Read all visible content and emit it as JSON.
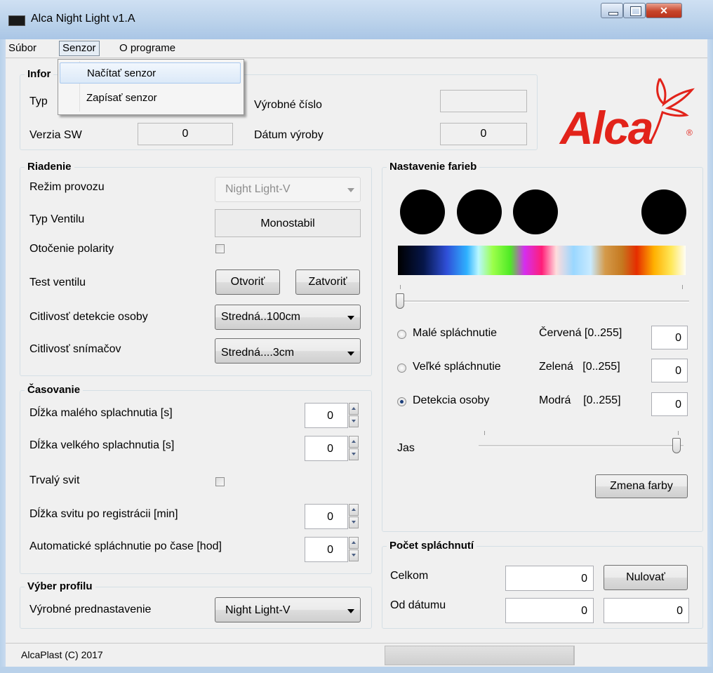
{
  "window": {
    "title": "Alca Night Light  v1.A"
  },
  "menu": {
    "items": [
      "Súbor",
      "Senzor",
      "O programe"
    ],
    "dropdown": [
      "Načítať senzor",
      "Zapísať senzor"
    ]
  },
  "info": {
    "title": "Infor",
    "typ_label": "Typ",
    "serial_label": "Výrobné číslo",
    "serial_value": "",
    "sw_label": "Verzia SW",
    "sw_value": "0",
    "date_label": "Dátum výroby",
    "date_value": "0"
  },
  "logo": {
    "text": "Alca",
    "mark": "®",
    "color": "#e2231a"
  },
  "control": {
    "title": "Riadenie",
    "mode_label": "Režim provozu",
    "mode_value": "Night Light-V",
    "valve_label": "Typ Ventilu",
    "valve_value": "Monostabil",
    "polarity_label": "Otočenie polarity",
    "polarity_checked": false,
    "test_label": "Test ventilu",
    "open_btn": "Otvoriť",
    "close_btn": "Zatvoriť",
    "person_sens_label": "Citlivosť detekcie osoby",
    "person_sens_value": "Stredná..100cm",
    "sensor_sens_label": "Citlivosť snímačov",
    "sensor_sens_value": "Stredná....3cm"
  },
  "timing": {
    "title": "Časovanie",
    "small_flush_label": "Dĺžka malého splachnutia [s]",
    "small_flush_value": "0",
    "big_flush_label": "Dĺžka velkého splachnutia [s]",
    "big_flush_value": "0",
    "permanent_label": "Trvalý svit",
    "permanent_checked": false,
    "light_len_label": "Dĺžka svitu po registrácii [min]",
    "light_len_value": "0",
    "auto_flush_label": "Automatické spláchnutie po čase [hod]",
    "auto_flush_value": "0"
  },
  "profile": {
    "title": "Výber profilu",
    "label": "Výrobné prednastavenie",
    "value": "Night Light-V"
  },
  "colors": {
    "title": "Nastavenie farieb",
    "swatches": [
      "#000000",
      "#000000",
      "#000000",
      "#000000"
    ],
    "slider_value": 0,
    "radio_small": "Malé spláchnutie",
    "radio_big": "Veľké spláchnutie",
    "radio_detect": "Detekcia osoby",
    "selected": "detect",
    "red_label": "Červená [0..255]",
    "red_value": "0",
    "green_label": "Zelená   [0..255]",
    "green_value": "0",
    "blue_label": "Modrá    [0..255]",
    "blue_value": "0",
    "brightness_label": "Jas",
    "brightness_value": 1.0,
    "change_btn": "Zmena farby"
  },
  "flush_count": {
    "title": "Počet spláchnutí",
    "total_label": "Celkom",
    "total_value": "0",
    "reset_btn": "Nulovať",
    "since_label": "Od dátumu",
    "since_count": "0",
    "since_date": "0"
  },
  "status": {
    "text": "AlcaPlast  (C) 2017"
  }
}
